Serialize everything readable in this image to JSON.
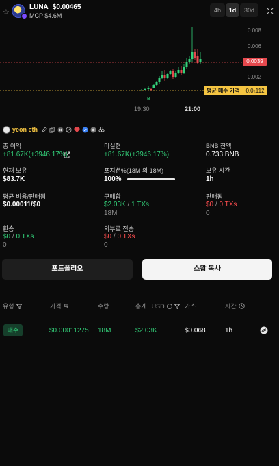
{
  "token": {
    "symbol": "LUNA",
    "price": "$0.00465",
    "mcap": "MCP $4.6M"
  },
  "timeframes": [
    {
      "label": "4h",
      "active": false
    },
    {
      "label": "1d",
      "active": true
    },
    {
      "label": "30d",
      "active": false
    }
  ],
  "chart": {
    "y_ticks": [
      "0.008",
      "0.006",
      "0.002"
    ],
    "price_tag": "0.0039",
    "avg_label": "평균 매수 가격",
    "avg_value": "0.0₅112",
    "x_ticks": [
      "19:30",
      "21:00"
    ],
    "marker": "B",
    "colors": {
      "up": "#33d17a",
      "down": "#e5484d",
      "avg": "#f5c542"
    }
  },
  "wallet": {
    "name": "yeon eth",
    "icons": [
      "edit-icon",
      "copy-icon",
      "x-icon",
      "block-icon",
      "heart-icon",
      "verified-icon",
      "scanner-icon",
      "binoculars-icon"
    ]
  },
  "stats": {
    "total_pnl_label": "총 이익",
    "total_pnl_value": "+81.67K(+3946.17%)",
    "unrealized_label": "미실현",
    "unrealized_value": "+81.67K(+3946.17%)",
    "bnb_label": "BNB 잔액",
    "bnb_value": "0.733 BNB",
    "holding_label": "현재 보유",
    "holding_value": "$83.7K",
    "position_label": "포지션%(18M 의 18M)",
    "position_value": "100%",
    "position_fraction": 1.0,
    "hold_time_label": "보유 시간",
    "hold_time_value": "1h",
    "avg_cost_label": "평균 비용/판매됨",
    "avg_cost_value": "$0.00011/$0",
    "bought_label": "구매함",
    "bought_amount": "$2.03K",
    "bought_sep": " / ",
    "bought_txs": "1 TXs",
    "bought_sub": "18M",
    "sold_label": "판매됨",
    "sold_amount": "$0",
    "sold_sep": " / ",
    "sold_txs": "0 TXs",
    "sold_sub": "0",
    "refund_label": "환승",
    "refund_amount": "$0",
    "refund_sep": " / ",
    "refund_txs": "0 TXs",
    "refund_sub": "0",
    "transfer_label": "외부로 전송",
    "transfer_amount": "$0",
    "transfer_sep": " / ",
    "transfer_txs": "0 TXs",
    "transfer_sub": "0"
  },
  "buttons": {
    "portfolio": "포트폴리오",
    "copy_swap": "스왑 복사"
  },
  "table": {
    "headers": {
      "type": "유형",
      "price": "가격",
      "amount": "수량",
      "total": "총계",
      "total_unit": "USD",
      "gas": "가스",
      "time": "시간"
    },
    "rows": [
      {
        "type": "매수",
        "price": "$0.00011275",
        "amount": "18M",
        "total": "$2.03K",
        "gas": "$0.068",
        "time": "1h"
      }
    ]
  }
}
